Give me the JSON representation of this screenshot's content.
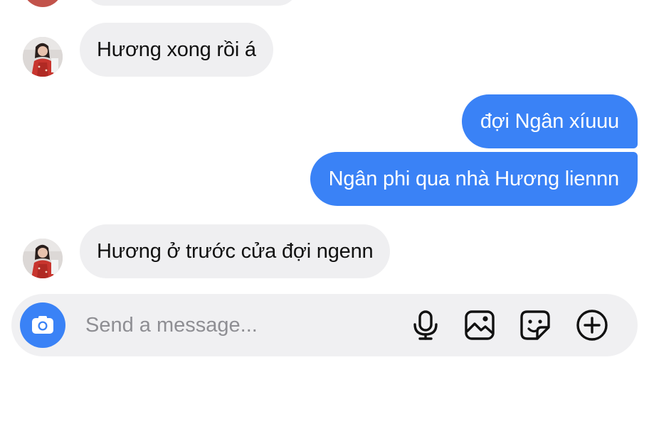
{
  "messages": [
    {
      "side": "incoming",
      "text": "Hương xong rồi á"
    },
    {
      "side": "outgoing",
      "text": "đợi Ngân xíuuu"
    },
    {
      "side": "outgoing",
      "text": "Ngân phi qua nhà Hương liennn"
    },
    {
      "side": "incoming",
      "text": "Hương ở trước cửa đợi ngenn"
    }
  ],
  "composer": {
    "placeholder": "Send a message...",
    "value": ""
  },
  "icons": {
    "camera": "camera-icon",
    "microphone": "microphone-icon",
    "gallery": "image-icon",
    "sticker": "sticker-icon",
    "more": "plus-circle-icon"
  },
  "colors": {
    "outgoing_bubble": "#3a82f6",
    "incoming_bubble": "#efeff1",
    "composer_background": "#f0f0f2",
    "placeholder": "#8e8e93"
  }
}
